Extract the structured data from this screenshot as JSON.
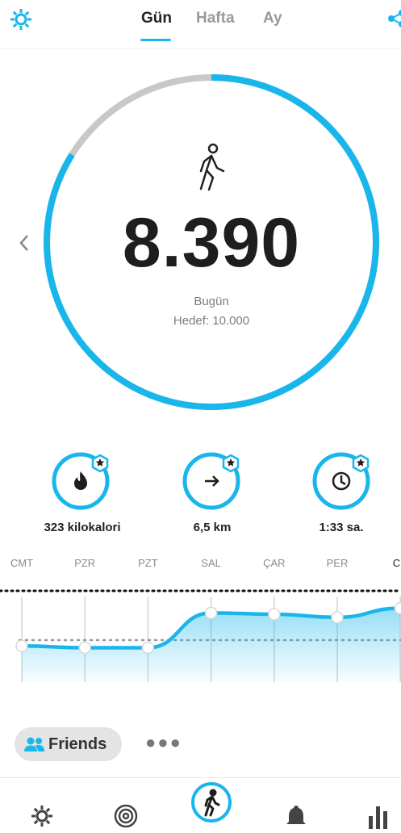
{
  "header": {
    "tabs": [
      {
        "label": "Gün",
        "active": true
      },
      {
        "label": "Hafta",
        "active": false
      },
      {
        "label": "Ay",
        "active": false
      }
    ],
    "settings_icon": "gear-icon",
    "share_icon": "share-icon"
  },
  "ring": {
    "steps": "8.390",
    "day_label": "Bugün",
    "goal_label": "Hedef: 10.000",
    "progress": 0.839,
    "icon": "walking-person-icon",
    "prev_icon": "chevron-left-icon"
  },
  "stats": [
    {
      "label": "323 kilokalori",
      "icon": "flame-icon",
      "badge_icon": "star-icon"
    },
    {
      "label": "6,5 km",
      "icon": "arrow-right-icon",
      "badge_icon": "star-icon"
    },
    {
      "label": "1:33 sa.",
      "icon": "clock-icon",
      "badge_icon": "star-icon"
    }
  ],
  "colors": {
    "accent": "#19b6ec",
    "track": "#c8c8c8"
  },
  "chart_data": {
    "type": "area",
    "categories": [
      "CMT",
      "PZR",
      "PZT",
      "SAL",
      "ÇAR",
      "PER",
      "CU"
    ],
    "values": [
      4100,
      3900,
      3900,
      7850,
      7700,
      7350,
      8390
    ],
    "goal_line": 10000,
    "ylim": [
      0,
      11000
    ],
    "grid": "vertical"
  },
  "friends": {
    "label": "Friends",
    "icon": "people-icon",
    "more_icon": "more-icon"
  },
  "bottom_nav": [
    "gear-icon",
    "target-icon",
    "walking-person-icon",
    "bell-icon",
    "bar-chart-icon"
  ]
}
